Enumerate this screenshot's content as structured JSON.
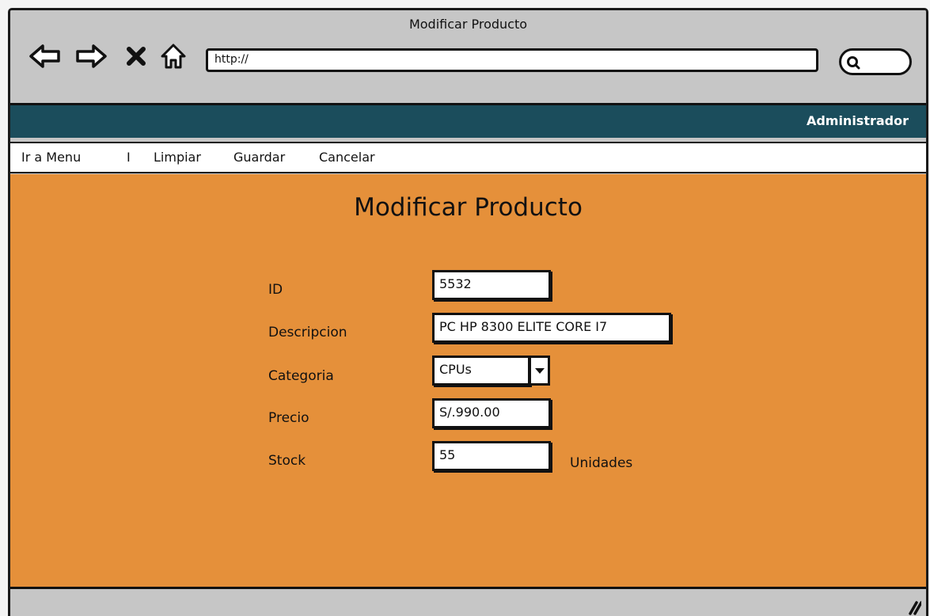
{
  "window": {
    "title": "Modificar Producto"
  },
  "browser": {
    "url": "http://",
    "icons": [
      "back-arrow-icon",
      "forward-arrow-icon",
      "close-x-icon",
      "home-icon",
      "search-icon"
    ]
  },
  "header": {
    "user": "Administrador",
    "color": "#1b4d5c"
  },
  "menu": {
    "items": [
      "Ir a Menu",
      "I",
      "Limpiar",
      "Guardar",
      "Cancelar"
    ]
  },
  "form": {
    "title": "Modificar Producto",
    "fields": [
      {
        "label": "ID",
        "value": "5532"
      },
      {
        "label": "Descripcion",
        "value": "PC HP 8300 ELITE CORE I7"
      },
      {
        "label": "Categoria",
        "value": "CPUs"
      },
      {
        "label": "Precio",
        "value": "S/.990.00"
      },
      {
        "label": "Stock",
        "value": "55",
        "unit": "Unidades"
      }
    ]
  },
  "colors": {
    "content_bg": "#e5903a",
    "chrome_bg": "#c6c6c6"
  }
}
